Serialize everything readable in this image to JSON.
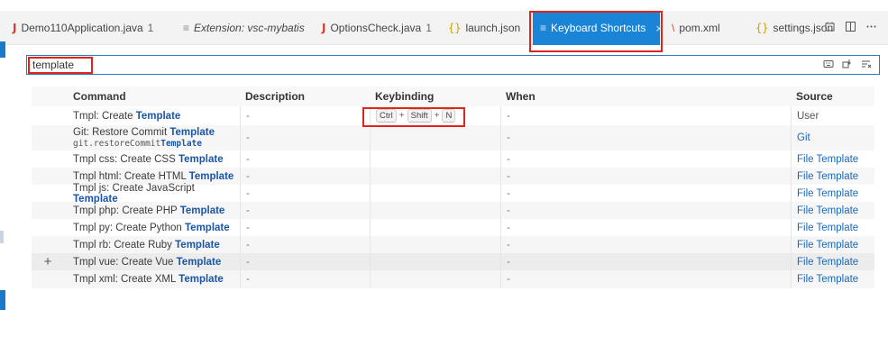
{
  "tabs": [
    {
      "icon": "J",
      "label": "Demo110Application.java",
      "badge": "1",
      "type": "java"
    },
    {
      "icon": "≡",
      "label": "Extension: vsc-mybatis",
      "badge": "",
      "type": "extension"
    },
    {
      "icon": "J",
      "label": "OptionsCheck.java",
      "badge": "1",
      "type": "java"
    },
    {
      "icon": "{}",
      "label": "launch.json",
      "badge": "",
      "type": "json"
    },
    {
      "icon": "≡",
      "label": "Keyboard Shortcuts",
      "badge": "",
      "type": "active"
    },
    {
      "icon": "\\",
      "label": "pom.xml",
      "badge": "",
      "type": "xml"
    },
    {
      "icon": "{}",
      "label": "settings.json",
      "badge": "",
      "type": "json"
    }
  ],
  "active_tab_close": "×",
  "search": {
    "value": "template"
  },
  "columns": {
    "command": "Command",
    "description": "Description",
    "keybinding": "Keybinding",
    "when": "When",
    "source": "Source"
  },
  "rows": [
    {
      "cmd_pre": "Tmpl: Create ",
      "cmd_match": "Template",
      "cmd_id_pre": "",
      "cmd_id_match": "",
      "description": "-",
      "keys": [
        "Ctrl",
        "Shift",
        "N"
      ],
      "when": "-",
      "source": "User"
    },
    {
      "cmd_pre": "Git: Restore Commit ",
      "cmd_match": "Template",
      "cmd_id_pre": "git.restoreCommit",
      "cmd_id_match": "Template",
      "description": "-",
      "keys": [],
      "when": "-",
      "source": "Git"
    },
    {
      "cmd_pre": "Tmpl css: Create CSS ",
      "cmd_match": "Template",
      "cmd_id_pre": "",
      "cmd_id_match": "",
      "description": "-",
      "keys": [],
      "when": "-",
      "source": "File Template"
    },
    {
      "cmd_pre": "Tmpl html: Create HTML ",
      "cmd_match": "Template",
      "cmd_id_pre": "",
      "cmd_id_match": "",
      "description": "-",
      "keys": [],
      "when": "-",
      "source": "File Template"
    },
    {
      "cmd_pre": "Tmpl js: Create JavaScript ",
      "cmd_match": "Template",
      "cmd_id_pre": "",
      "cmd_id_match": "",
      "description": "-",
      "keys": [],
      "when": "-",
      "source": "File Template"
    },
    {
      "cmd_pre": "Tmpl php: Create PHP ",
      "cmd_match": "Template",
      "cmd_id_pre": "",
      "cmd_id_match": "",
      "description": "-",
      "keys": [],
      "when": "-",
      "source": "File Template"
    },
    {
      "cmd_pre": "Tmpl py: Create Python ",
      "cmd_match": "Template",
      "cmd_id_pre": "",
      "cmd_id_match": "",
      "description": "-",
      "keys": [],
      "when": "-",
      "source": "File Template"
    },
    {
      "cmd_pre": "Tmpl rb: Create Ruby ",
      "cmd_match": "Template",
      "cmd_id_pre": "",
      "cmd_id_match": "",
      "description": "-",
      "keys": [],
      "when": "-",
      "source": "File Template"
    },
    {
      "cmd_pre": "Tmpl vue: Create Vue ",
      "cmd_match": "Template",
      "cmd_id_pre": "",
      "cmd_id_match": "",
      "description": "-",
      "keys": [],
      "when": "-",
      "source": "File Template"
    },
    {
      "cmd_pre": "Tmpl xml: Create XML ",
      "cmd_match": "Template",
      "cmd_id_pre": "",
      "cmd_id_match": "",
      "description": "-",
      "keys": [],
      "when": "-",
      "source": "File Template"
    }
  ],
  "hover_row_add": "+",
  "colors": {
    "accent": "#1a85d6",
    "highlight_box": "#e0241b",
    "match_text": "#1a56a8",
    "link": "#1a69b8"
  }
}
